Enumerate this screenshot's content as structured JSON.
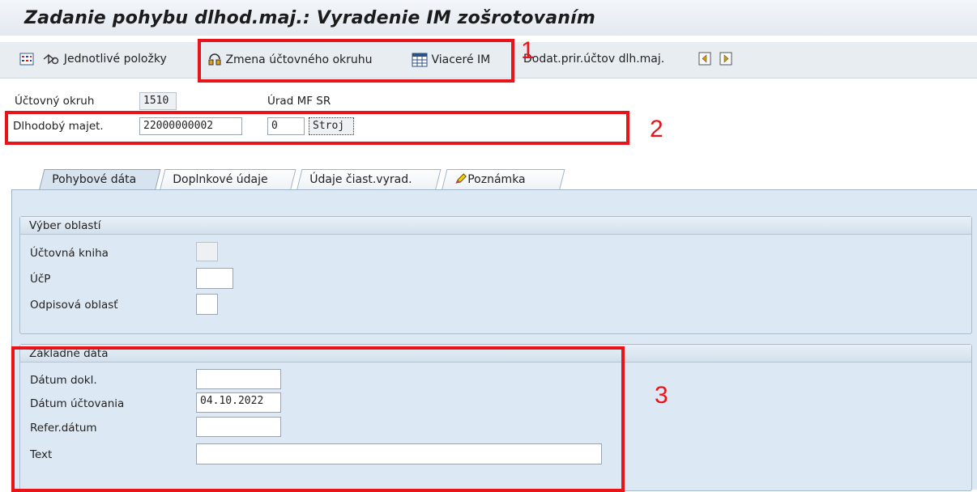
{
  "window": {
    "title": "Zadanie pohybu dlhod.maj.: Vyradenie IM zošrotovaním"
  },
  "toolbar": {
    "items": [
      {
        "label": "Jednotlivé položky",
        "icon": "list-items-icon"
      },
      {
        "label": "Zmena účtovného okruhu",
        "icon": "change-company-code-icon"
      },
      {
        "label": "Viaceré IM",
        "icon": "multiple-assets-icon"
      },
      {
        "label": "Dodat.prir.účtov dlh.maj.",
        "icon": ""
      }
    ],
    "nav_icons": [
      "prev-page-icon",
      "next-page-icon"
    ]
  },
  "header": {
    "company_code_label": "Účtovný okruh",
    "company_code_value": "1510",
    "company_code_name": "Úrad MF SR",
    "asset_label": "Dlhodobý majet.",
    "asset_number": "22000000002",
    "asset_subnumber": "0",
    "asset_class": "Stroj"
  },
  "tabs": [
    {
      "label": "Pohybové dáta",
      "active": true
    },
    {
      "label": "Doplnkové údaje",
      "active": false
    },
    {
      "label": "Údaje čiast.vyrad.",
      "active": false
    },
    {
      "label": "Poznámka",
      "active": false,
      "icon": "note-pencil-icon"
    }
  ],
  "area_selection": {
    "title": "Výber oblastí",
    "fields": [
      {
        "label": "Účtovná kniha",
        "value": ""
      },
      {
        "label": "ÚčP",
        "value": ""
      },
      {
        "label": "Odpisová oblasť",
        "value": ""
      }
    ]
  },
  "basic_data": {
    "title": "Základné dáta",
    "fields": [
      {
        "label": "Dátum dokl.",
        "value": ""
      },
      {
        "label": "Dátum účtovania",
        "value": "04.10.2022"
      },
      {
        "label": "Refer.dátum",
        "value": ""
      },
      {
        "label": "Text",
        "value": ""
      }
    ]
  },
  "annotations": {
    "one": "1",
    "two": "2",
    "three": "3"
  },
  "colors": {
    "annotation_red": "#e8141a",
    "panel_blue": "#dce8f3",
    "toolbar_gray": "#e8edf2"
  }
}
